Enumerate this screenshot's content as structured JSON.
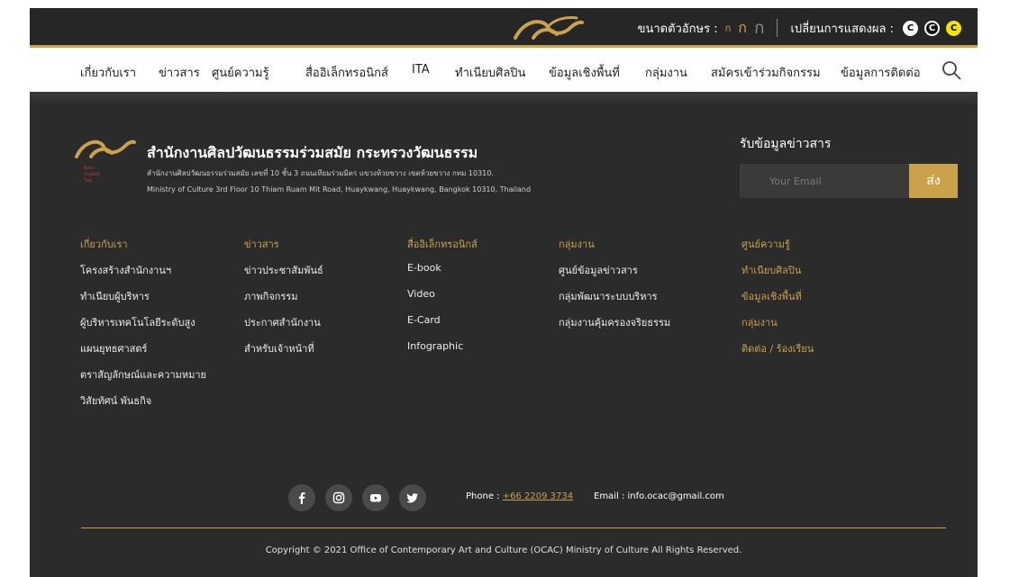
{
  "topbar": {
    "font_size_label": "ขนาดตัวอักษร :",
    "font_sizes": [
      "ก",
      "ก",
      "ก"
    ],
    "display_label": "เปลี่ยนการแสดงผล :",
    "contrast_modes": [
      "C",
      "C",
      "C"
    ]
  },
  "nav": {
    "items": [
      "เกี่ยวกับเรา",
      "ข่าวสาร",
      "ศูนย์ความรู้",
      "สื่ออิเล็กทรอนิกส์",
      "ITA",
      "ทำเนียบศิลปิน",
      "ข้อมูลเชิงพื้นที่",
      "กลุ่มงาน",
      "สมัครเข้าร่วมกิจกรรม",
      "ข้อมูลการติดต่อ"
    ]
  },
  "org": {
    "logo_text": [
      "ศิลปะ",
      "ร่วมสมัย",
      "ไทย"
    ],
    "name": "สำนักงานศิลปวัฒนธรรมร่วมสมัย กระทรวงวัฒนธรรม",
    "address_th": "สำนักงานศิลปวัฒนธรรมร่วมสมัย เลขที่ 10 ชั้น 3 ถนนเทียมร่วมมิตร แขวงห้วยขวาง เขตห้วยขวาง กทม 10310.",
    "address_en": "Ministry of Culture 3rd Floor 10 Thiam Ruam Mit Road, Huaykwang, Huaykwang, Bangkok 10310, Thailand"
  },
  "newsletter": {
    "title": "รับข้อมูลข่าวสาร",
    "placeholder": "Your Email",
    "send_label": "ส่ง"
  },
  "columns": [
    {
      "head": "เกี่ยวกับเรา",
      "links": [
        "โครงสร้างสำนักงานฯ",
        "ทำเนียบผู้บริหาร",
        "ผู้บริหารเทคโนโลยีระดับสูง",
        "แผนยุทธศาสตร์",
        "ตราสัญลักษณ์และความหมาย",
        "วิสัยทัศน์ พันธกิจ"
      ]
    },
    {
      "head": "ข่าวสาร",
      "links": [
        "ข่าวประชาสัมพันธ์",
        "ภาพกิจกรรม",
        "ประกาศสำนักงาน",
        "สำหรับเจ้าหน้าที่"
      ]
    },
    {
      "head": "สื่ออิเล็กทรอนิกส์",
      "links": [
        "E-book",
        "Video",
        "E-Card",
        "Infographic"
      ]
    },
    {
      "head": "กลุ่มงาน",
      "links": [
        "ศูนย์ข้อมูลข่าวสาร",
        "กลุ่มพัฒนาระบบบริหาร",
        "กลุ่มงานคุ้มครองจริยธรรม"
      ]
    },
    {
      "head": "ศูนย์ความรู้",
      "links": [
        "ทำเนียบศิลปิน",
        "ข้อมูลเชิงพื้นที่",
        "กลุ่มงาน",
        "ติดต่อ / ร้องเรียน"
      ]
    }
  ],
  "contact": {
    "phone_label": "Phone : ",
    "phone": "+66 2209 3734",
    "email": "Email : info.ocac@gmail.com"
  },
  "social": [
    "facebook-icon",
    "instagram-icon",
    "youtube-icon",
    "twitter-icon"
  ],
  "copyright": "Copyright © 2021 Office of Contemporary Art and Culture (OCAC) Ministry of Culture All Rights Reserved.",
  "colors": {
    "accent": "#c9a24a",
    "topbar": "#262626",
    "footer": "#2b2b2b"
  }
}
